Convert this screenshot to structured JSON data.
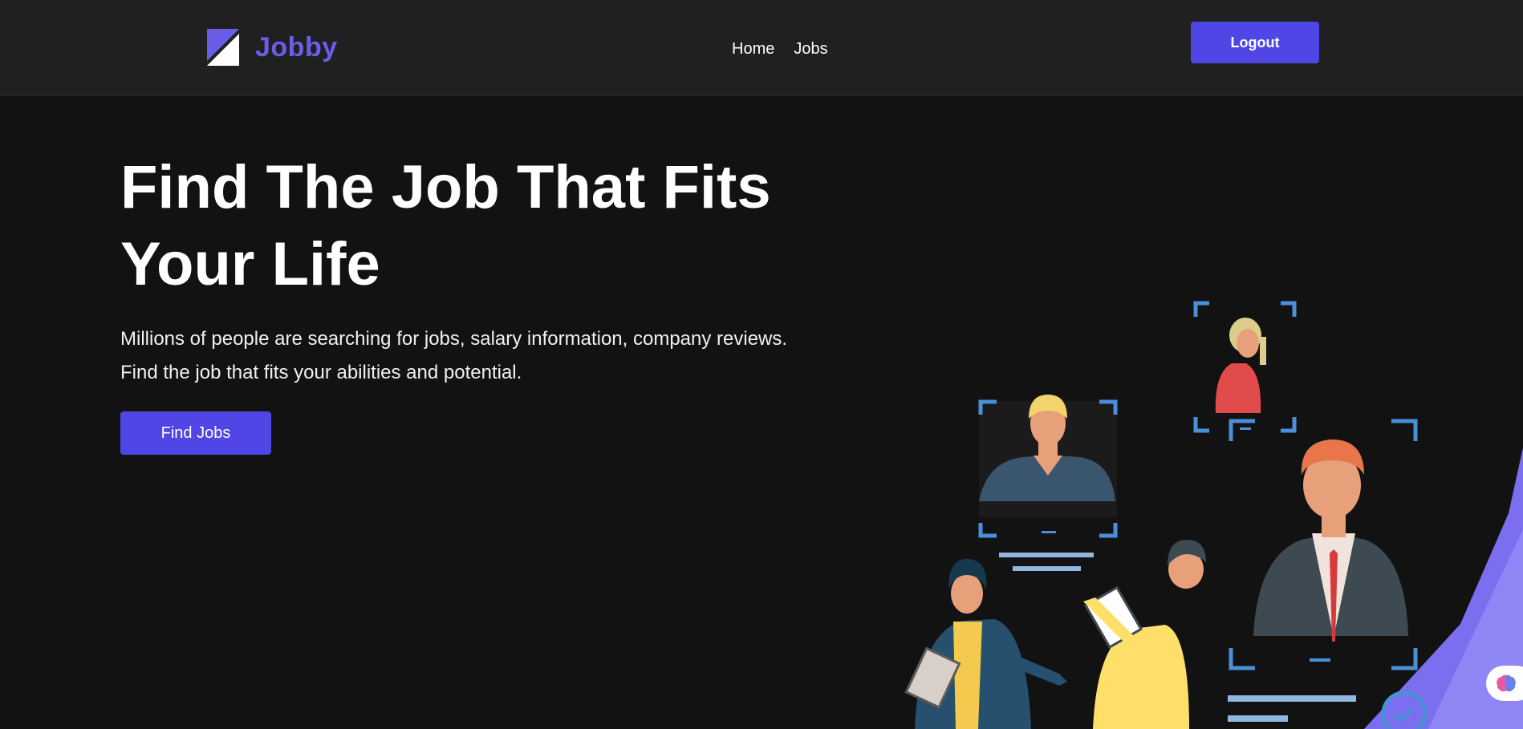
{
  "brand": {
    "name": "Jobby",
    "accent": "#4f46e5",
    "logo_color": "#6a5ee8"
  },
  "nav": {
    "links": [
      {
        "label": "Home"
      },
      {
        "label": "Jobs"
      }
    ],
    "logout_label": "Logout"
  },
  "hero": {
    "title": "Find The Job That Fits Your Life",
    "description_line1": "Millions of people are searching for jobs, salary information, company reviews.",
    "description_line2": "Find the job that fits your abilities and potential.",
    "cta_label": "Find Jobs"
  },
  "illustration": {
    "icon": "job-search-people-illustration"
  },
  "floating_button": {
    "icon": "brain-icon"
  },
  "colors": {
    "background": "#121212",
    "navbar": "#202020"
  }
}
